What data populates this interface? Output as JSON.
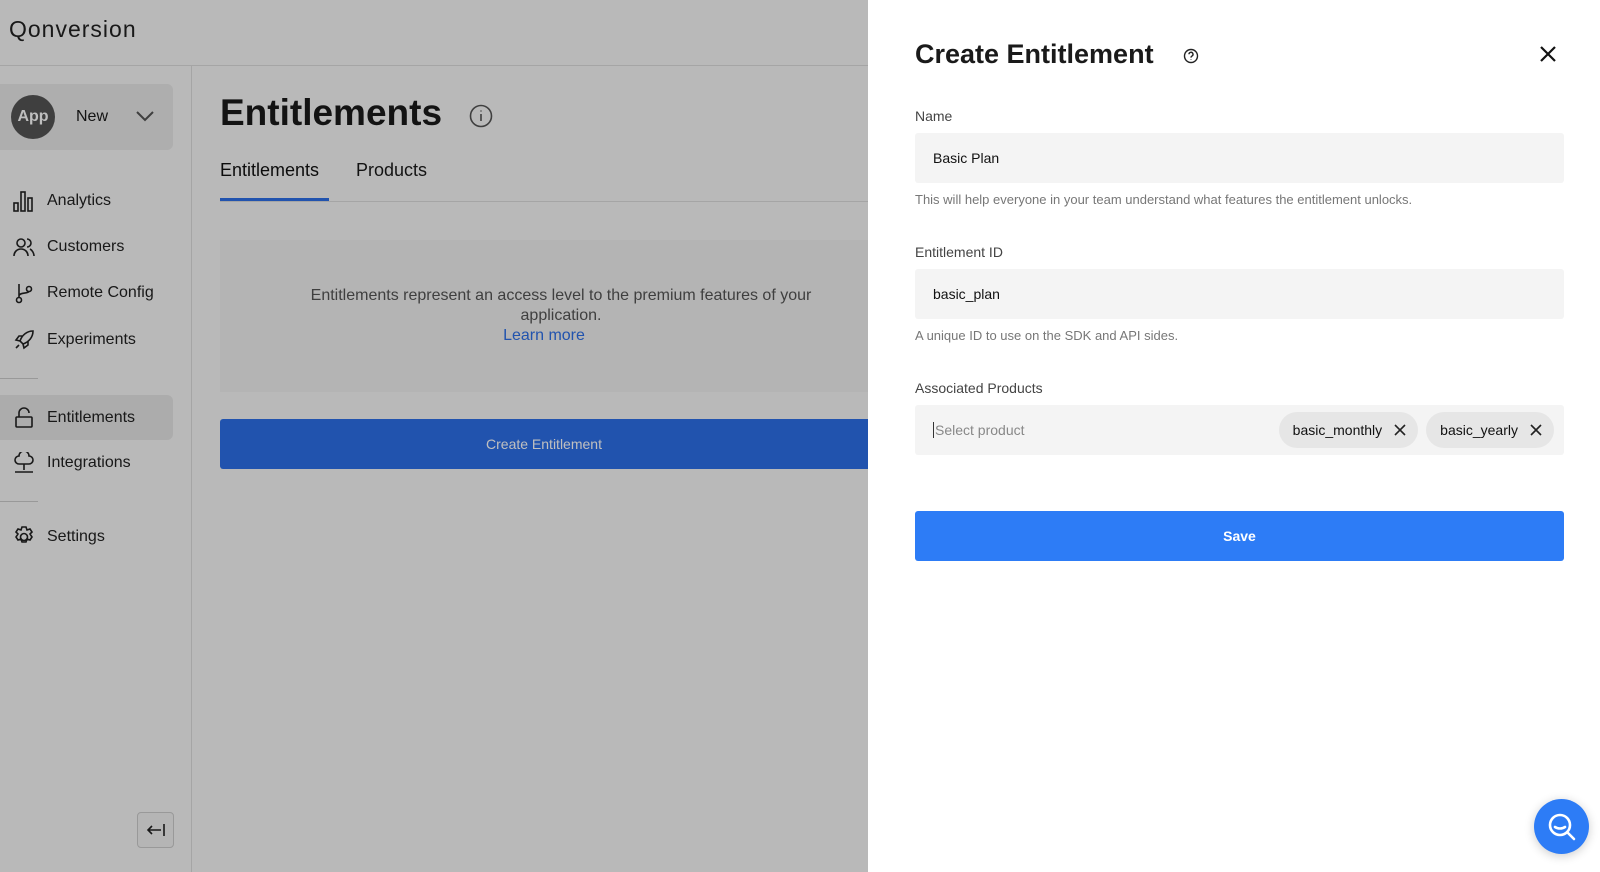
{
  "app": {
    "logo": "Qonversion"
  },
  "sidebar": {
    "app_avatar": "App",
    "app_name": "New",
    "items": [
      {
        "label": "Analytics",
        "icon": "bar-chart-icon"
      },
      {
        "label": "Customers",
        "icon": "users-icon"
      },
      {
        "label": "Remote Config",
        "icon": "branch-icon"
      },
      {
        "label": "Experiments",
        "icon": "rocket-icon"
      },
      {
        "label": "Entitlements",
        "icon": "lock-open-icon",
        "active": true
      },
      {
        "label": "Integrations",
        "icon": "cloud-network-icon"
      },
      {
        "label": "Settings",
        "icon": "gear-icon"
      }
    ]
  },
  "main": {
    "title": "Entitlements",
    "tabs": [
      {
        "label": "Entitlements",
        "active": true
      },
      {
        "label": "Products"
      }
    ],
    "empty_text": "Entitlements represent an access level to the premium features of your application.",
    "learn_more": "Learn more",
    "create_button": "Create Entitlement"
  },
  "panel": {
    "title": "Create Entitlement",
    "name_label": "Name",
    "name_value": "Basic Plan",
    "name_hint": "This will help everyone in your team understand what features the entitlement unlocks.",
    "id_label": "Entitlement ID",
    "id_value": "basic_plan",
    "id_hint": "A unique ID to use on the SDK and API sides.",
    "products_label": "Associated Products",
    "products_placeholder": "Select product",
    "products": [
      "basic_monthly",
      "basic_yearly"
    ],
    "save": "Save"
  },
  "colors": {
    "accent": "#2d7cf6",
    "primary_dark": "#2d6fe8"
  }
}
